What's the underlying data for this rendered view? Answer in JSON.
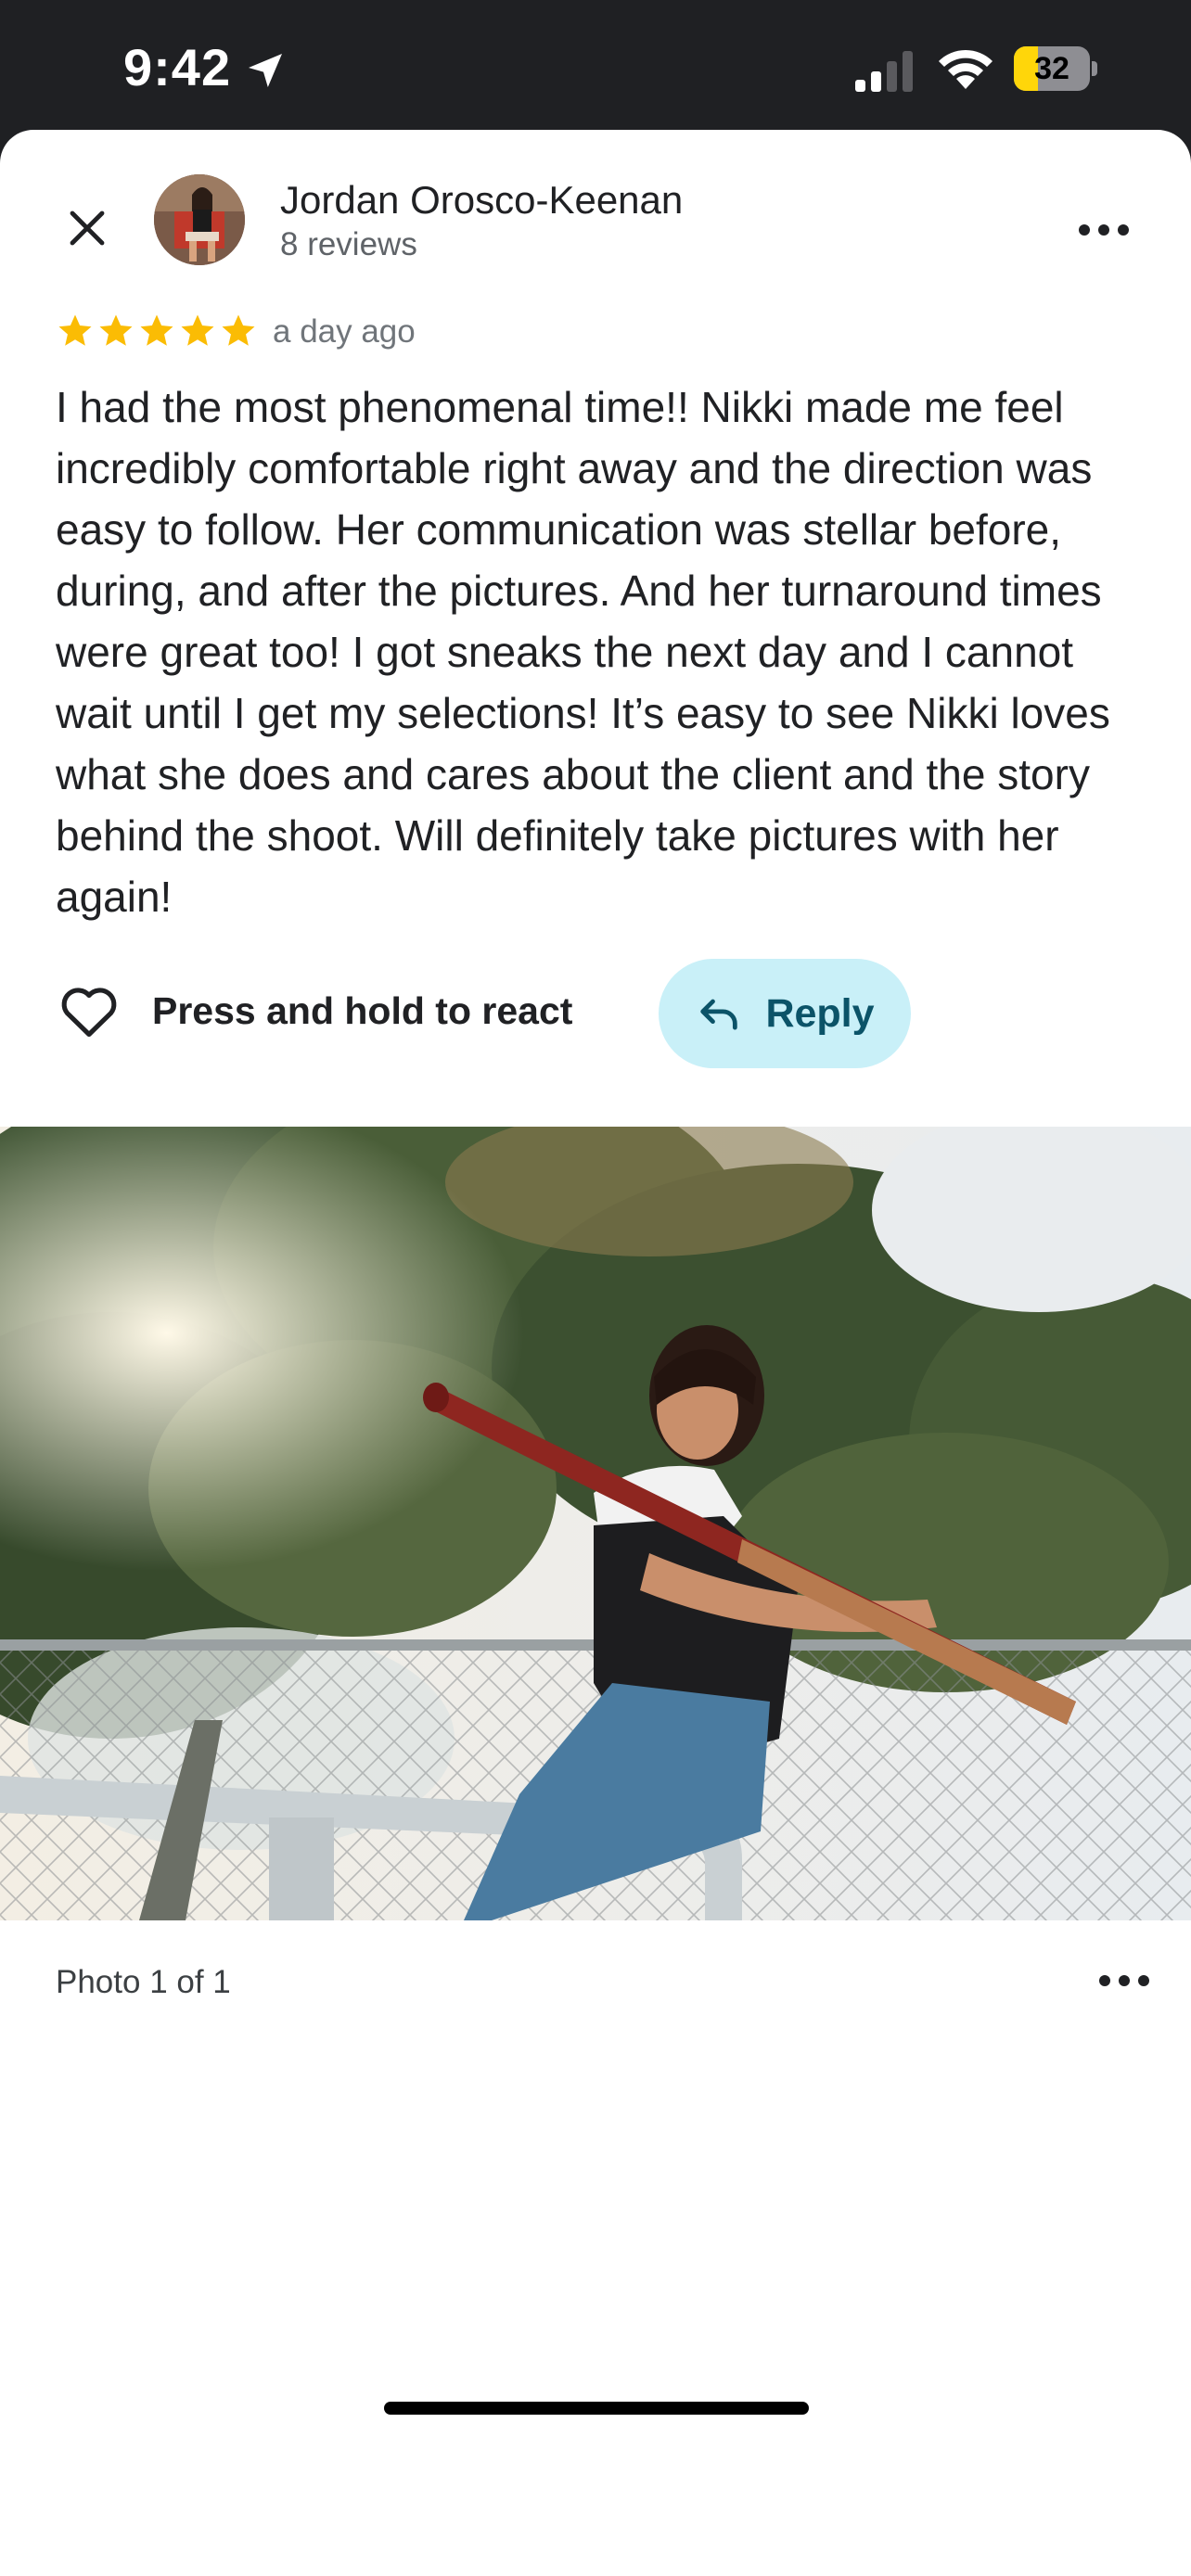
{
  "status_bar": {
    "time": "9:42",
    "battery_percent": "32",
    "battery_level": 0.32,
    "icons": [
      "location-arrow-icon",
      "signal-icon",
      "wifi-icon",
      "battery-icon"
    ]
  },
  "header": {
    "close_icon": "close-icon",
    "reviewer_name": "Jordan Orosco-Keenan",
    "review_count": "8 reviews",
    "more_icon": "more-horizontal-icon"
  },
  "review": {
    "rating": 5,
    "max_rating": 5,
    "star_color": "#fbbc04",
    "date": "a day ago",
    "text": "I had the most phenomenal time!! Nikki made me feel incredibly comfortable right away and the direction was easy to follow. Her communication was stellar before, during, and after the pictures. And her turnaround times were great too! I got sneaks the next day and I cannot wait until I get my selections! It’s easy to see Nikki loves what she does and cares about the client and the story behind the shoot. Will definitely take pictures with her again!"
  },
  "actions": {
    "react_label": "Press and hold to react",
    "reply_label": "Reply",
    "reply_bg": "#c9f0f8",
    "reply_color": "#0b5368"
  },
  "photo": {
    "caption": "Photo 1 of 1"
  }
}
